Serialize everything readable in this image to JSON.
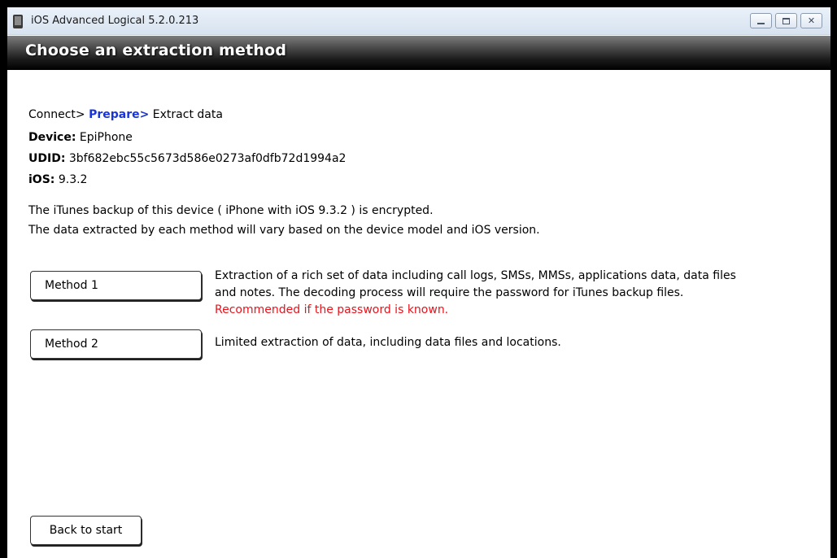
{
  "window": {
    "title": "iOS Advanced Logical 5.2.0.213"
  },
  "header": {
    "title": "Choose an extraction method"
  },
  "breadcrumb": {
    "step1": "Connect>",
    "step2": "Prepare>",
    "step3": "Extract data"
  },
  "device_info": {
    "device_label": "Device:",
    "device_value": "EpiPhone",
    "udid_label": "UDID:",
    "udid_value": "3bf682ebc55c5673d586e0273af0dfb72d1994a2",
    "ios_label": "iOS:",
    "ios_value": "9.3.2"
  },
  "messages": {
    "line1": "The iTunes backup of this device ( iPhone with iOS 9.3.2 ) is encrypted.",
    "line2": "The data extracted by each method will vary based on the device model and iOS version."
  },
  "methods": [
    {
      "label": "Method 1",
      "description_line1": "Extraction of a rich set of data including call logs, SMSs, MMSs, applications data, data files",
      "description_line2": "and notes. The decoding process will require the password for iTunes backup files.",
      "note": "Recommended if the password is known."
    },
    {
      "label": "Method 2",
      "description_line1": "Limited extraction of data, including data files and locations."
    }
  ],
  "footer": {
    "back_label": "Back to start"
  },
  "colors": {
    "accent_blue": "#1a35d6",
    "recommend_red": "#e8121a",
    "header_dark": "#000000"
  }
}
